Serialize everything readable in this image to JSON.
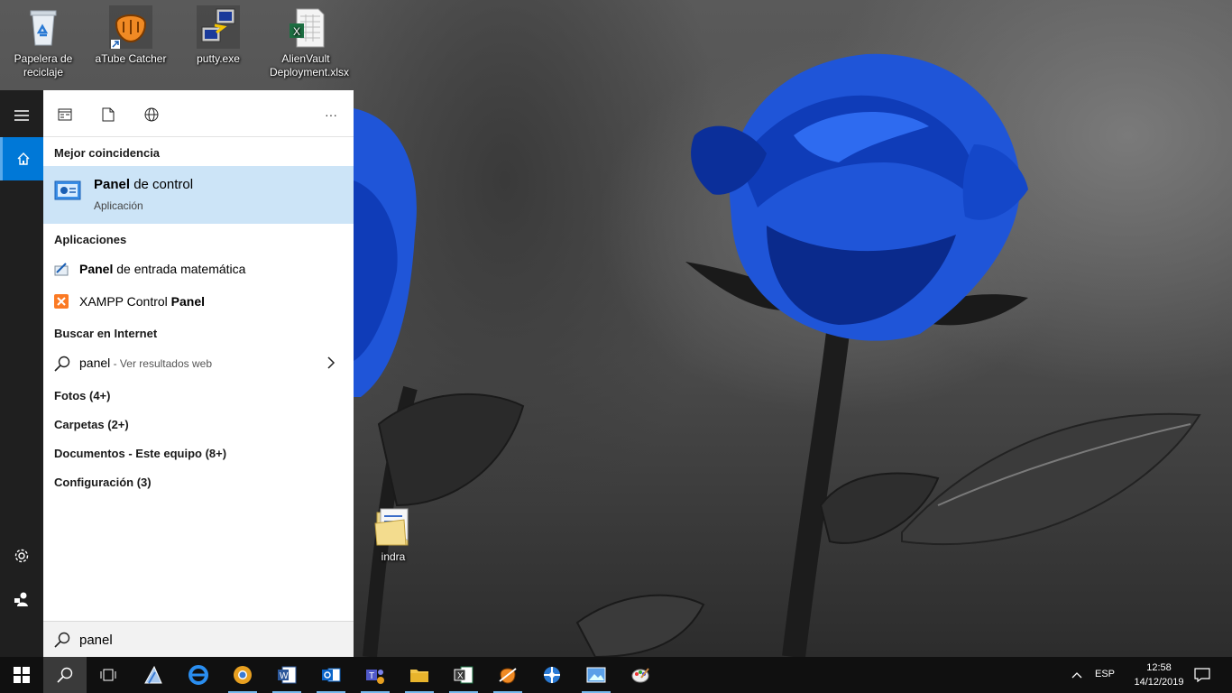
{
  "desktop": {
    "icons": [
      {
        "label": "Papelera de reciclaje",
        "icon": "recycle-bin-icon"
      },
      {
        "label": "aTube Catcher",
        "icon": "atube-catcher-icon"
      },
      {
        "label": "putty.exe",
        "icon": "putty-icon"
      },
      {
        "label": "AlienVault Deployment.xlsx",
        "icon": "excel-file-icon"
      },
      {
        "label": "indra",
        "icon": "folder-icon"
      }
    ]
  },
  "rail": {
    "menu_icon": "hamburger-icon",
    "home_icon": "home-icon",
    "settings_icon": "gear-icon",
    "user_icon": "user-icon"
  },
  "topbar": {
    "filters": [
      "apps-filter-icon",
      "documents-filter-icon",
      "web-filter-icon"
    ],
    "more_label": "···"
  },
  "results": {
    "best_match_title": "Mejor coincidencia",
    "best_match": {
      "name_bold": "Panel",
      "name_rest": " de control",
      "type": "Aplicación"
    },
    "apps_title": "Aplicaciones",
    "apps": [
      {
        "before": "",
        "bold": "Panel",
        "after": " de entrada matemática",
        "icon": "math-input-icon"
      },
      {
        "before": "XAMPP Control ",
        "bold": "Panel",
        "after": "",
        "icon": "xampp-icon"
      }
    ],
    "web_title": "Buscar en Internet",
    "web": {
      "query": "panel",
      "suffix": " - Ver resultados web"
    },
    "categories": [
      "Fotos (4+)",
      "Carpetas (2+)",
      "Documentos - Este equipo (8+)",
      "Configuración (3)"
    ]
  },
  "search": {
    "value": "panel"
  },
  "taskbar": {
    "apps": [
      "task-view-icon",
      "azure-icon",
      "edge-icon",
      "chrome-icon",
      "word-icon",
      "outlook-icon",
      "teams-icon",
      "file-explorer-icon",
      "excel-icon",
      "atube-icon",
      "vpn-icon",
      "photos-icon",
      "paint-icon"
    ],
    "language": "ESP",
    "time": "12:58",
    "date": "14/12/2019"
  },
  "colors": {
    "selection": "#cce4f7",
    "accent": "#0078d7",
    "taskbar": "#101010"
  }
}
